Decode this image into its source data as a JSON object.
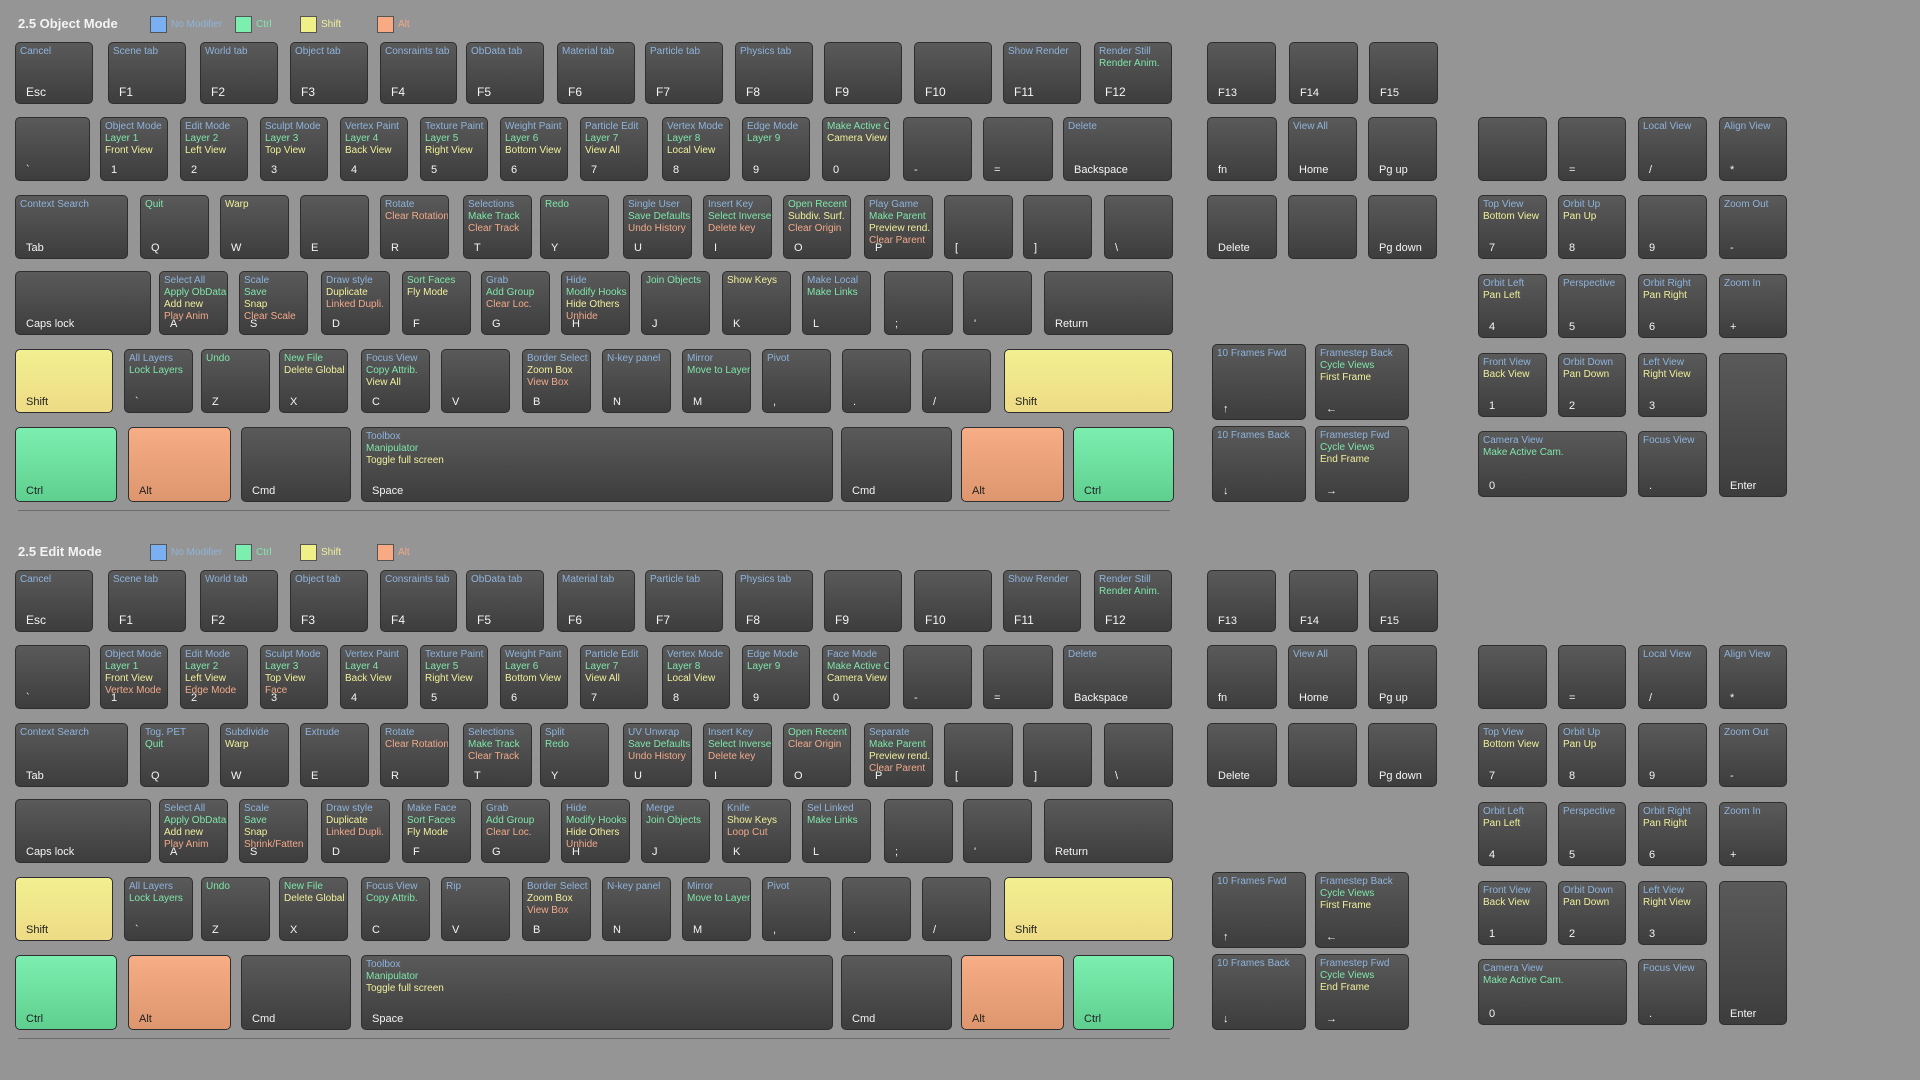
{
  "legend": [
    {
      "label": "No Modifier",
      "color": "#7ab0f2",
      "text_class": "c-blue"
    },
    {
      "label": "Ctrl",
      "color": "#7cefb0",
      "text_class": "c-green"
    },
    {
      "label": "Shift",
      "color": "#f0ef88",
      "text_class": "c-yellow"
    },
    {
      "label": "Alt",
      "color": "#f7aa84",
      "text_class": "c-orange"
    }
  ],
  "sections": [
    {
      "title": "2.5 Object Mode",
      "keys": [
        {
          "label": "Esc",
          "big": true,
          "b": "Cancel"
        },
        {
          "label": "F1",
          "big": true,
          "b": "Scene tab"
        },
        {
          "label": "F2",
          "big": true,
          "b": "World tab"
        },
        {
          "label": "F3",
          "big": true,
          "b": "Object tab"
        },
        {
          "label": "F4",
          "big": true,
          "b": "Consraints tab"
        },
        {
          "label": "F5",
          "big": true,
          "b": "ObData tab"
        },
        {
          "label": "F6",
          "big": true,
          "b": "Material tab"
        },
        {
          "label": "F7",
          "big": true,
          "b": "Particle tab"
        },
        {
          "label": "F8",
          "big": true,
          "b": "Physics tab"
        },
        {
          "label": "F9",
          "big": true
        },
        {
          "label": "F10",
          "big": true
        },
        {
          "label": "F11",
          "big": true,
          "b": "Show Render"
        },
        {
          "label": "F12",
          "big": true,
          "b": "Render Still",
          "c": "Render Anim."
        },
        {
          "label": "F13"
        },
        {
          "label": "F14"
        },
        {
          "label": "F15"
        },
        {
          "label": "`"
        },
        {
          "label": "1",
          "b": "Object Mode",
          "c": "Layer 1",
          "s": "Front View"
        },
        {
          "label": "2",
          "b": "Edit Mode",
          "c": "Layer 2",
          "s": "Left View"
        },
        {
          "label": "3",
          "b": "Sculpt Mode",
          "c": "Layer 3",
          "s": "Top View"
        },
        {
          "label": "4",
          "b": "Vertex Paint",
          "c": "Layer 4",
          "s": "Back View"
        },
        {
          "label": "5",
          "b": "Texture Paint",
          "c": "Layer 5",
          "s": "Right View"
        },
        {
          "label": "6",
          "b": "Weight Paint",
          "c": "Layer 6",
          "s": "Bottom View"
        },
        {
          "label": "7",
          "b": "Particle Edit",
          "c": "Layer 7",
          "s": "View All"
        },
        {
          "label": "8",
          "b": "Vertex Mode",
          "c": "Layer 8",
          "s": "Local View"
        },
        {
          "label": "9",
          "b": "Edge Mode",
          "c": "Layer 9"
        },
        {
          "label": "0",
          "c": "Make Active Cam.",
          "s": "Camera View"
        },
        {
          "label": "-"
        },
        {
          "label": "="
        },
        {
          "label": "Backspace",
          "b": "Delete"
        },
        {
          "label": "fn"
        },
        {
          "label": "Home",
          "b": "View All"
        },
        {
          "label": "Pg up"
        },
        {
          "label": "Tab",
          "b": "Context Search"
        },
        {
          "label": "Q",
          "c": "Quit"
        },
        {
          "label": "W",
          "s": "Warp"
        },
        {
          "label": "E"
        },
        {
          "label": "R",
          "b": "Rotate",
          "a": "Clear Rotation"
        },
        {
          "label": "T",
          "b": "Selections",
          "c": "Make Track",
          "a": "Clear Track"
        },
        {
          "label": "Y",
          "c": "Redo"
        },
        {
          "label": "U",
          "b": "Single User",
          "c": "Save Defaults",
          "a": "Undo History"
        },
        {
          "label": "I",
          "b": "Insert Key",
          "c": "Select Inverse",
          "a": "Delete key"
        },
        {
          "label": "O",
          "c": "Open Recent",
          "s": "Subdiv. Surf.",
          "a": "Clear Origin"
        },
        {
          "label": "P",
          "b": "Play Game",
          "c": "Make Parent",
          "s": "Preview rend.",
          "a": "Clear Parent"
        },
        {
          "label": "["
        },
        {
          "label": "]"
        },
        {
          "label": "\\"
        },
        {
          "label": "Delete"
        },
        {
          "label": ""
        },
        {
          "label": "Pg down"
        },
        {
          "label": "Caps lock"
        },
        {
          "label": "A",
          "b": "Select All",
          "c": "Apply ObData",
          "s": "Add new",
          "a": "Play Anim"
        },
        {
          "label": "S",
          "b": "Scale",
          "c": "Save",
          "s": "Snap",
          "a": "Clear Scale"
        },
        {
          "label": "D",
          "b": "Draw style",
          "s": "Duplicate",
          "a": "Linked Dupli."
        },
        {
          "label": "F",
          "c": "Sort Faces",
          "s": "Fly Mode"
        },
        {
          "label": "G",
          "b": "Grab",
          "c": "Add Group",
          "a": "Clear Loc."
        },
        {
          "label": "H",
          "b": "Hide",
          "c": "Modify Hooks",
          "s": "Hide Others",
          "a": "Unhide"
        },
        {
          "label": "J",
          "c": "Join Objects"
        },
        {
          "label": "K",
          "s": "Show Keys"
        },
        {
          "label": "L",
          "b": "Make Local",
          "c": "Make Links"
        },
        {
          "label": ";"
        },
        {
          "label": "'"
        },
        {
          "label": "Return"
        },
        {
          "label": "Shift",
          "mod": "shift"
        },
        {
          "label": "`",
          "b": "All Layers",
          "c": "Lock Layers"
        },
        {
          "label": "Z",
          "c": "Undo"
        },
        {
          "label": "X",
          "c": "New File",
          "s": "Delete Global"
        },
        {
          "label": "C",
          "b": "Focus View",
          "c": "Copy Attrib.",
          "s": "View All"
        },
        {
          "label": "V"
        },
        {
          "label": "B",
          "b": "Border Select",
          "s": "Zoom Box",
          "a": "View Box"
        },
        {
          "label": "N",
          "b": "N-key panel"
        },
        {
          "label": "M",
          "b": "Mirror",
          "c": "Move to Layer"
        },
        {
          "label": ",",
          "b": "Pivot"
        },
        {
          "label": "."
        },
        {
          "label": "/"
        },
        {
          "label": "Shift",
          "mod": "shift"
        },
        {
          "label": "↑",
          "b": "10 Frames Fwd"
        },
        {
          "label": "←",
          "b": "Framestep Back",
          "c": "Cycle Views",
          "s": "First Frame"
        },
        {
          "label": "Ctrl",
          "mod": "ctrl"
        },
        {
          "label": "Alt",
          "mod": "alt"
        },
        {
          "label": "Cmd"
        },
        {
          "label": "Space",
          "b": "Toolbox",
          "c": "Manipulator",
          "s": "Toggle full screen"
        },
        {
          "label": "Cmd"
        },
        {
          "label": "Alt",
          "mod": "alt"
        },
        {
          "label": "Ctrl",
          "mod": "ctrl"
        },
        {
          "label": "↓",
          "b": "10 Frames Back"
        },
        {
          "label": "→",
          "b": "Framestep Fwd",
          "c": "Cycle Views",
          "s": "End Frame"
        },
        {
          "label": ""
        },
        {
          "label": "="
        },
        {
          "label": "/",
          "b": "Local View"
        },
        {
          "label": "*",
          "b": "Align View"
        },
        {
          "label": "7",
          "b": "Top View",
          "s": "Bottom View"
        },
        {
          "label": "8",
          "b": "Orbit Up",
          "s": "Pan Up"
        },
        {
          "label": "9"
        },
        {
          "label": "-",
          "b": "Zoom Out"
        },
        {
          "label": "4",
          "b": "Orbit Left",
          "s": "Pan Left"
        },
        {
          "label": "5",
          "b": "Perspective"
        },
        {
          "label": "6",
          "b": "Orbit Right",
          "s": "Pan Right"
        },
        {
          "label": "+",
          "b": "Zoom In"
        },
        {
          "label": "1",
          "b": "Front View",
          "s": "Back View"
        },
        {
          "label": "2",
          "b": "Orbit Down",
          "s": "Pan Down"
        },
        {
          "label": "3",
          "b": "Left View",
          "s": "Right View"
        },
        {
          "label": "Enter"
        },
        {
          "label": "0",
          "b": "Camera View",
          "c": "Make Active Cam."
        },
        {
          "label": ".",
          "b": "Focus View"
        }
      ]
    },
    {
      "title": "2.5 Edit Mode",
      "keys": [
        {
          "label": "Esc",
          "big": true,
          "b": "Cancel"
        },
        {
          "label": "F1",
          "big": true,
          "b": "Scene tab"
        },
        {
          "label": "F2",
          "big": true,
          "b": "World tab"
        },
        {
          "label": "F3",
          "big": true,
          "b": "Object tab"
        },
        {
          "label": "F4",
          "big": true,
          "b": "Consraints tab"
        },
        {
          "label": "F5",
          "big": true,
          "b": "ObData tab"
        },
        {
          "label": "F6",
          "big": true,
          "b": "Material tab"
        },
        {
          "label": "F7",
          "big": true,
          "b": "Particle tab"
        },
        {
          "label": "F8",
          "big": true,
          "b": "Physics tab"
        },
        {
          "label": "F9",
          "big": true
        },
        {
          "label": "F10",
          "big": true
        },
        {
          "label": "F11",
          "big": true,
          "b": "Show Render"
        },
        {
          "label": "F12",
          "big": true,
          "b": "Render Still",
          "c": "Render Anim."
        },
        {
          "label": "F13"
        },
        {
          "label": "F14"
        },
        {
          "label": "F15"
        },
        {
          "label": "`"
        },
        {
          "label": "1",
          "b": "Object Mode",
          "c": "Layer 1",
          "s": "Front View",
          "a": "Vertex Mode"
        },
        {
          "label": "2",
          "b": "Edit Mode",
          "c": "Layer 2",
          "s": "Left View",
          "a": "Edge Mode"
        },
        {
          "label": "3",
          "b": "Sculpt Mode",
          "c": "Layer 3",
          "s": "Top View",
          "a": "Face"
        },
        {
          "label": "4",
          "b": "Vertex Paint",
          "c": "Layer 4",
          "s": "Back View"
        },
        {
          "label": "5",
          "b": "Texture Paint",
          "c": "Layer 5",
          "s": "Right View"
        },
        {
          "label": "6",
          "b": "Weight Paint",
          "c": "Layer 6",
          "s": "Bottom View"
        },
        {
          "label": "7",
          "b": "Particle Edit",
          "c": "Layer 7",
          "s": "View All"
        },
        {
          "label": "8",
          "b": "Vertex Mode",
          "c": "Layer 8",
          "s": "Local View"
        },
        {
          "label": "9",
          "b": "Edge Mode",
          "c": "Layer 9"
        },
        {
          "label": "0",
          "b": "Face Mode",
          "c": "Make Active Cam.",
          "s": "Camera View"
        },
        {
          "label": "-"
        },
        {
          "label": "="
        },
        {
          "label": "Backspace",
          "b": "Delete"
        },
        {
          "label": "fn"
        },
        {
          "label": "Home",
          "b": "View All"
        },
        {
          "label": "Pg up"
        },
        {
          "label": "Tab",
          "b": "Context Search"
        },
        {
          "label": "Q",
          "b": "Tog. PET",
          "c": "Quit"
        },
        {
          "label": "W",
          "b": "Subdivide",
          "s": "Warp"
        },
        {
          "label": "E",
          "b": "Extrude"
        },
        {
          "label": "R",
          "b": "Rotate",
          "a": "Clear Rotation"
        },
        {
          "label": "T",
          "b": "Selections",
          "c": "Make Track",
          "a": "Clear Track"
        },
        {
          "label": "Y",
          "b": "Split",
          "c": "Redo"
        },
        {
          "label": "U",
          "b": "UV Unwrap",
          "c": "Save Defaults",
          "a": "Undo History"
        },
        {
          "label": "I",
          "b": "Insert Key",
          "c": "Select Inverse",
          "a": "Delete key"
        },
        {
          "label": "O",
          "c": "Open Recent",
          "a": "Clear Origin"
        },
        {
          "label": "P",
          "b": "Separate",
          "c": "Make Parent",
          "s": "Preview rend.",
          "a": "Clear Parent"
        },
        {
          "label": "["
        },
        {
          "label": "]"
        },
        {
          "label": "\\"
        },
        {
          "label": "Delete"
        },
        {
          "label": ""
        },
        {
          "label": "Pg down"
        },
        {
          "label": "Caps lock"
        },
        {
          "label": "A",
          "b": "Select All",
          "c": "Apply ObData",
          "s": "Add new",
          "a": "Play Anim"
        },
        {
          "label": "S",
          "b": "Scale",
          "c": "Save",
          "s": "Snap",
          "a": "Shrink/Fatten"
        },
        {
          "label": "D",
          "b": "Draw style",
          "s": "Duplicate",
          "a": "Linked Dupli."
        },
        {
          "label": "F",
          "b": "Make Face",
          "c": "Sort Faces",
          "s": "Fly Mode"
        },
        {
          "label": "G",
          "b": "Grab",
          "c": "Add Group",
          "a": "Clear Loc."
        },
        {
          "label": "H",
          "b": "Hide",
          "c": "Modify Hooks",
          "s": "Hide Others",
          "a": "Unhide"
        },
        {
          "label": "J",
          "b": "Merge",
          "c": "Join Objects"
        },
        {
          "label": "K",
          "b": "Knife",
          "s": "Show Keys",
          "a": "Loop Cut"
        },
        {
          "label": "L",
          "b": "Sel Linked",
          "c": "Make Links"
        },
        {
          "label": ";"
        },
        {
          "label": "'"
        },
        {
          "label": "Return"
        },
        {
          "label": "Shift",
          "mod": "shift"
        },
        {
          "label": "`",
          "b": "All Layers",
          "c": "Lock Layers"
        },
        {
          "label": "Z",
          "c": "Undo"
        },
        {
          "label": "X",
          "c": "New File",
          "s": "Delete Global"
        },
        {
          "label": "C",
          "b": "Focus View",
          "c": "Copy Attrib."
        },
        {
          "label": "V",
          "b": "Rip"
        },
        {
          "label": "B",
          "b": "Border Select",
          "s": "Zoom Box",
          "a": "View Box"
        },
        {
          "label": "N",
          "b": "N-key panel"
        },
        {
          "label": "M",
          "b": "Mirror",
          "c": "Move to Layer"
        },
        {
          "label": ",",
          "b": "Pivot"
        },
        {
          "label": "."
        },
        {
          "label": "/"
        },
        {
          "label": "Shift",
          "mod": "shift"
        },
        {
          "label": "↑",
          "b": "10 Frames Fwd"
        },
        {
          "label": "←",
          "b": "Framestep Back",
          "c": "Cycle Views",
          "s": "First Frame"
        },
        {
          "label": "Ctrl",
          "mod": "ctrl"
        },
        {
          "label": "Alt",
          "mod": "alt"
        },
        {
          "label": "Cmd"
        },
        {
          "label": "Space",
          "b": "Toolbox",
          "c": "Manipulator",
          "s": "Toggle full screen"
        },
        {
          "label": "Cmd"
        },
        {
          "label": "Alt",
          "mod": "alt"
        },
        {
          "label": "Ctrl",
          "mod": "ctrl"
        },
        {
          "label": "↓",
          "b": "10 Frames Back"
        },
        {
          "label": "→",
          "b": "Framestep Fwd",
          "c": "Cycle Views",
          "s": "End Frame"
        },
        {
          "label": ""
        },
        {
          "label": "="
        },
        {
          "label": "/",
          "b": "Local View"
        },
        {
          "label": "*",
          "b": "Align View"
        },
        {
          "label": "7",
          "b": "Top View",
          "s": "Bottom View"
        },
        {
          "label": "8",
          "b": "Orbit Up",
          "s": "Pan Up"
        },
        {
          "label": "9"
        },
        {
          "label": "-",
          "b": "Zoom Out"
        },
        {
          "label": "4",
          "b": "Orbit Left",
          "s": "Pan Left"
        },
        {
          "label": "5",
          "b": "Perspective"
        },
        {
          "label": "6",
          "b": "Orbit Right",
          "s": "Pan Right"
        },
        {
          "label": "+",
          "b": "Zoom In"
        },
        {
          "label": "1",
          "b": "Front View",
          "s": "Back View"
        },
        {
          "label": "2",
          "b": "Orbit Down",
          "s": "Pan Down"
        },
        {
          "label": "3",
          "b": "Left View",
          "s": "Right View"
        },
        {
          "label": "Enter"
        },
        {
          "label": "0",
          "b": "Camera View",
          "c": "Make Active Cam."
        },
        {
          "label": ".",
          "b": "Focus View"
        }
      ]
    }
  ]
}
